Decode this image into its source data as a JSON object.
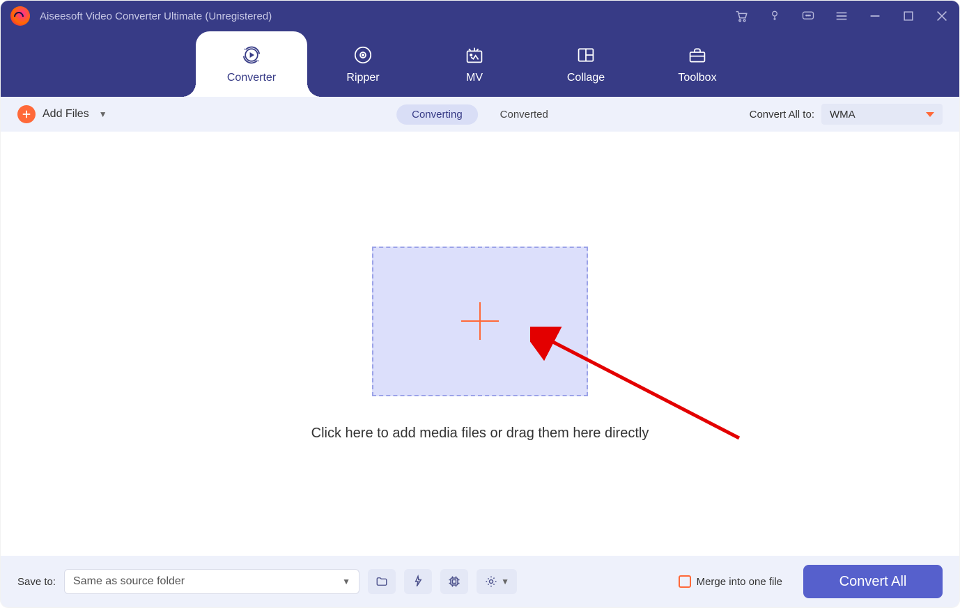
{
  "title": "Aiseesoft Video Converter Ultimate (Unregistered)",
  "nav": {
    "converter": "Converter",
    "ripper": "Ripper",
    "mv": "MV",
    "collage": "Collage",
    "toolbox": "Toolbox"
  },
  "toolbar": {
    "add_files": "Add Files",
    "converting": "Converting",
    "converted": "Converted",
    "convert_all_to_label": "Convert All to:",
    "format": "WMA"
  },
  "dropzone": {
    "hint": "Click here to add media files or drag them here directly"
  },
  "footer": {
    "save_to_label": "Save to:",
    "path": "Same as source folder",
    "merge_label": "Merge into one file",
    "convert_button": "Convert All"
  }
}
